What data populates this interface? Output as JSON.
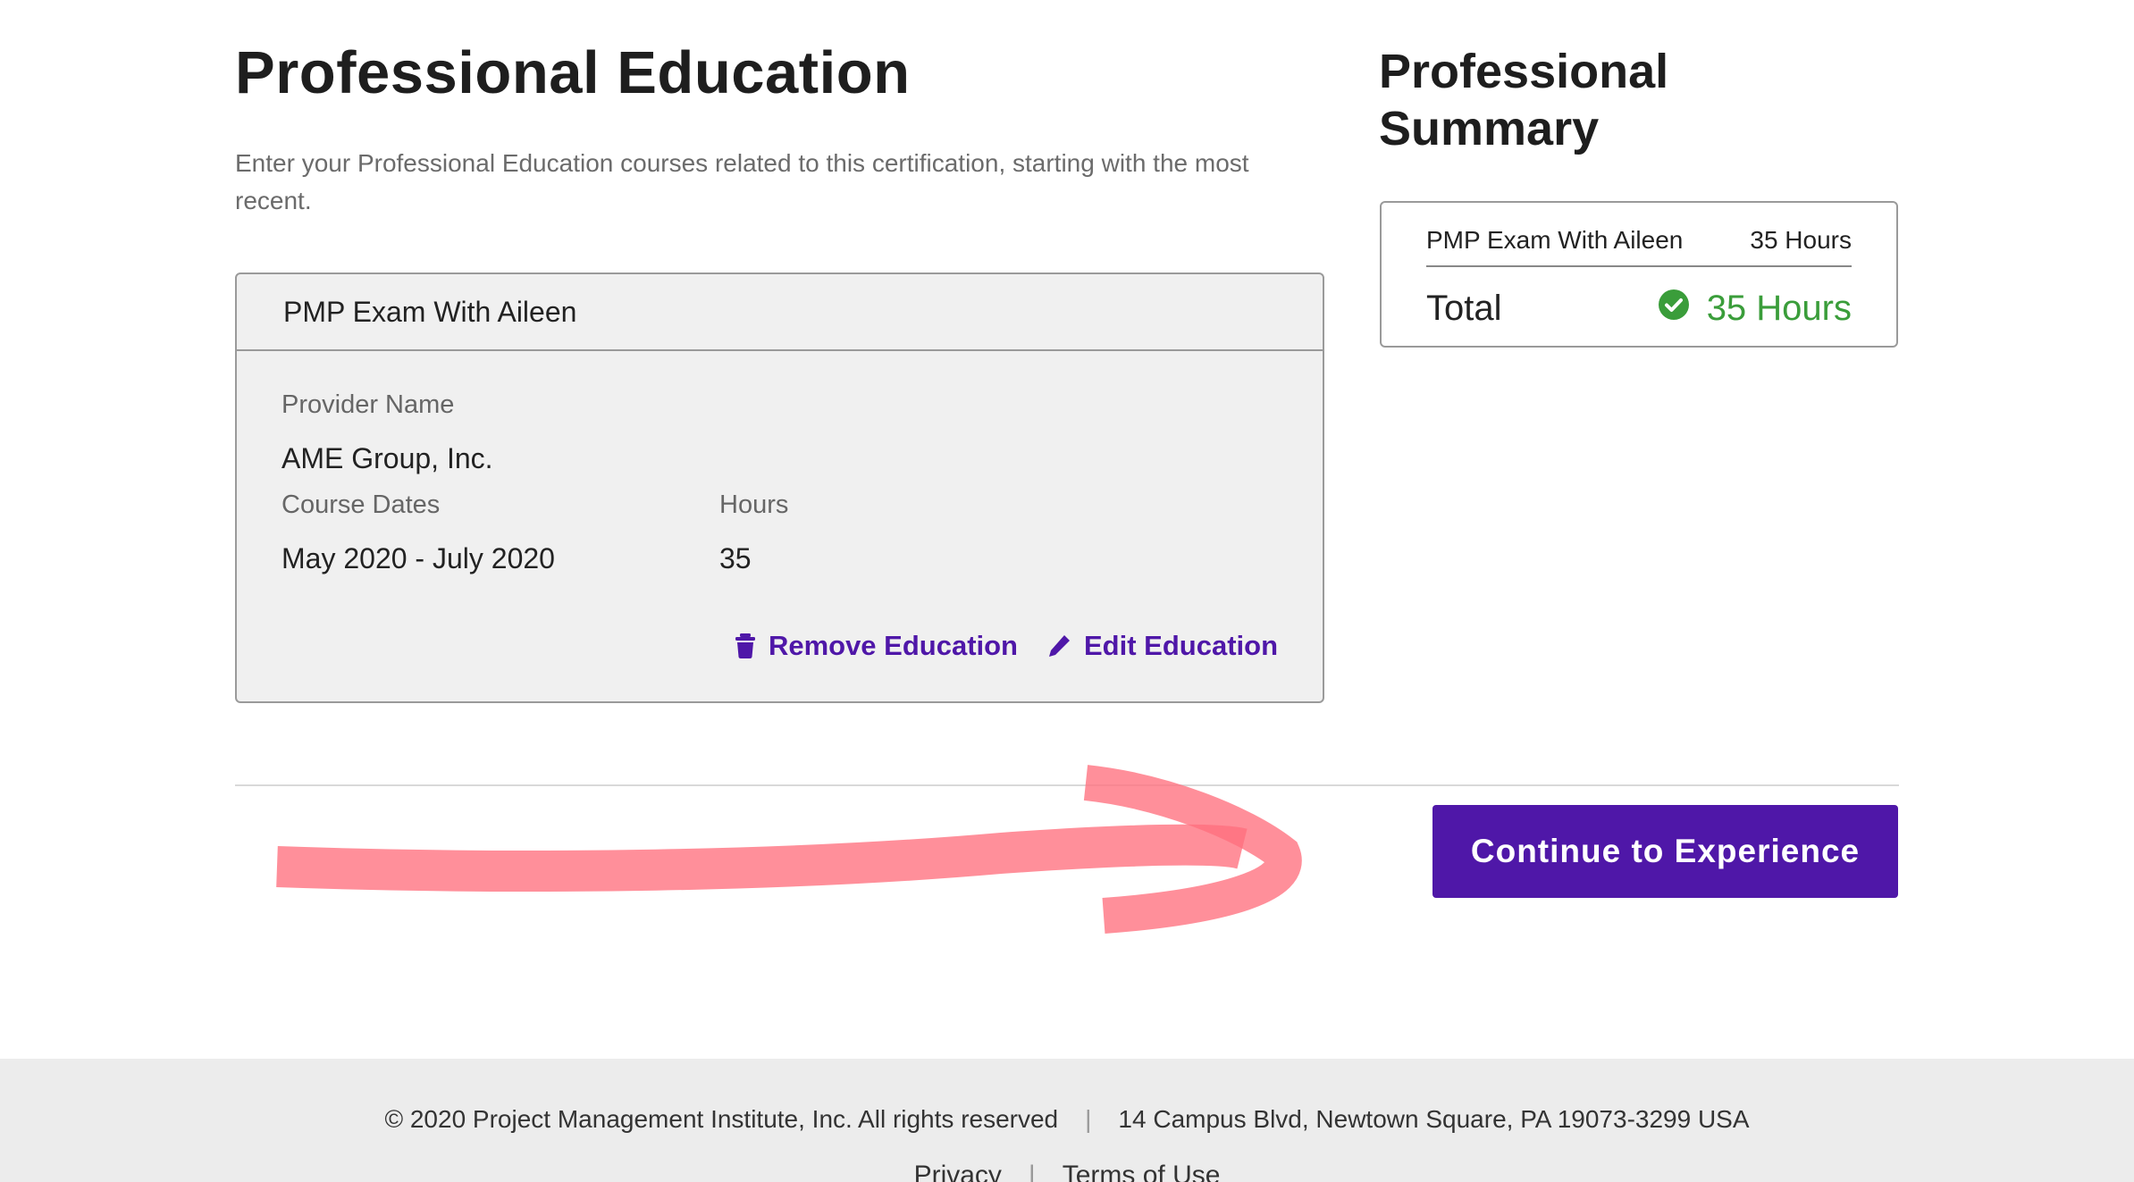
{
  "main": {
    "title": "Professional Education",
    "intro": "Enter your Professional Education courses related to this certification, starting with the most recent.",
    "course": {
      "name": "PMP Exam With Aileen",
      "provider_label": "Provider Name",
      "provider_value": "AME Group, Inc.",
      "dates_label": "Course Dates",
      "dates_value": "May 2020 - July 2020",
      "hours_label": "Hours",
      "hours_value": "35",
      "remove_label": "Remove Education",
      "edit_label": "Edit Education"
    },
    "continue_label": "Continue to Experience"
  },
  "summary": {
    "title": "Professional Summary",
    "row_name": "PMP Exam With Aileen",
    "row_hours": "35 Hours",
    "total_label": "Total",
    "total_value": "35 Hours"
  },
  "footer": {
    "copyright": "© 2020 Project Management Institute, Inc. All rights reserved",
    "separator": "|",
    "address": "14 Campus Blvd, Newtown Square, PA 19073-3299 USA",
    "privacy": "Privacy",
    "terms": "Terms of Use"
  },
  "icons": {
    "remove": "trash-icon",
    "edit": "pencil-icon",
    "total_status": "check-circle-icon"
  },
  "colors": {
    "accent": "#4f17a8",
    "success": "#3a9d3a",
    "annotation": "#ff6f7d"
  }
}
